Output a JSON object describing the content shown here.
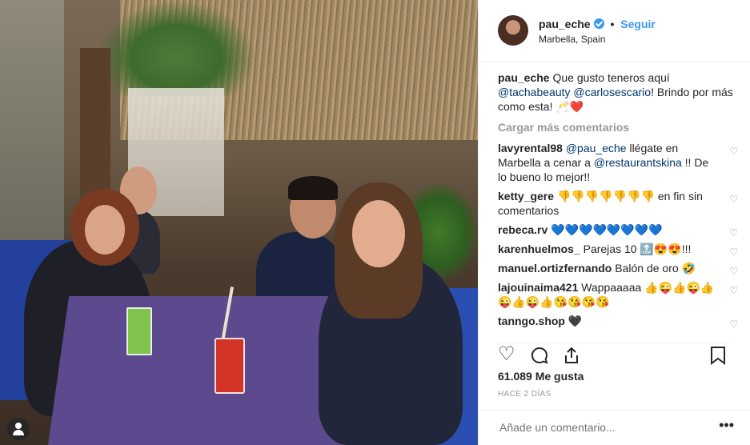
{
  "header": {
    "username": "pau_eche",
    "separator": "•",
    "follow_label": "Seguir",
    "location": "Marbella, Spain"
  },
  "caption": {
    "username": "pau_eche",
    "text_1": "Que gusto teneros aquí",
    "mention_1": "@tachabeauty",
    "mention_2": "@carlosescario",
    "text_2": "! Brindo por más como esta! 🥂❤️"
  },
  "load_more": "Cargar más comentarios",
  "comments": [
    {
      "username": "lavyrental98",
      "mention": "@pau_eche",
      "text": " llégate en Marbella a cenar a ",
      "mention2": "@restaurantskina",
      "text2": " !! De lo bueno lo mejor!!"
    },
    {
      "username": "ketty_gere",
      "text": "👎👎👎👎👎👎👎 en fin sin comentarios"
    },
    {
      "username": "rebeca.rv",
      "text": "💙💙💙💙💙💙💙💙"
    },
    {
      "username": "karenhuelmos_",
      "text": "Parejas 10 🔝😍😍!!!"
    },
    {
      "username": "manuel.ortizfernando",
      "text": "Balón de oro 🤣"
    },
    {
      "username": "lajouinaima421",
      "text": "Wappaaaaa 👍😜👍😜👍😜👍😜👍😘😘😘😘"
    },
    {
      "username": "tanngo.shop",
      "text": "🖤"
    }
  ],
  "actions": {
    "like_icon": "heart-outline-icon",
    "comment_icon": "comment-bubble-icon",
    "share_icon": "share-icon",
    "save_icon": "bookmark-icon"
  },
  "likes": "61.089 Me gusta",
  "time_ago": "HACE 2 DÍAS",
  "add_comment_placeholder": "Añade un comentario...",
  "more_label": "•••",
  "colors": {
    "link_blue": "#3897f0",
    "mention_blue": "#003569",
    "muted": "#999999",
    "border": "#efefef"
  }
}
